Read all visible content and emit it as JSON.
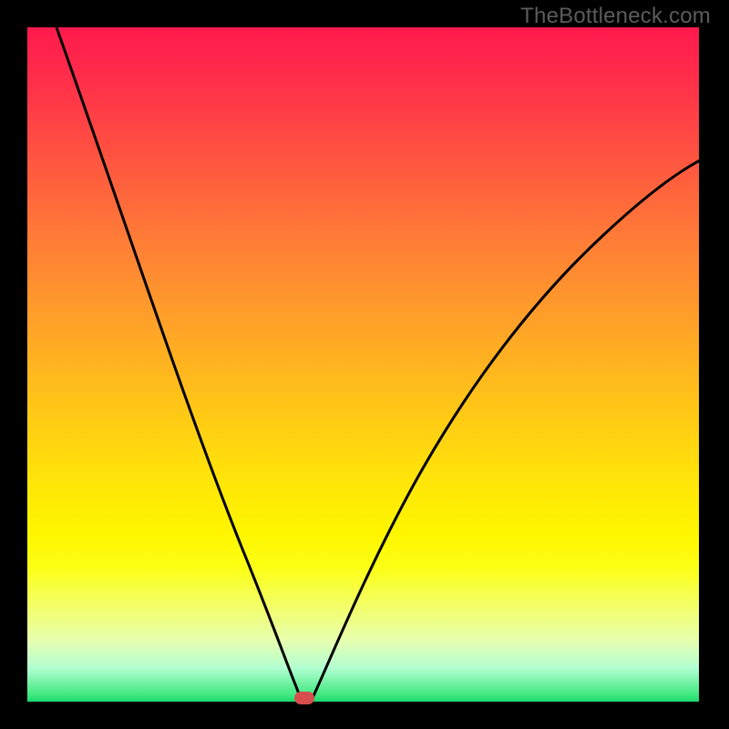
{
  "watermark": "TheBottleneck.com",
  "chart_data": {
    "type": "line",
    "title": "",
    "xlabel": "",
    "ylabel": "",
    "xlim": [
      0,
      100
    ],
    "ylim": [
      0,
      100
    ],
    "series": [
      {
        "name": "left-curve",
        "x": [
          4,
          10,
          16,
          22,
          28,
          32,
          35,
          37,
          38.5,
          40
        ],
        "y": [
          100,
          81,
          63,
          45,
          28,
          16,
          8,
          3,
          1,
          0
        ]
      },
      {
        "name": "right-curve",
        "x": [
          42,
          45,
          50,
          56,
          63,
          71,
          80,
          90,
          100
        ],
        "y": [
          0,
          5,
          15,
          28,
          41,
          53,
          63,
          71,
          77
        ]
      }
    ],
    "annotations": [
      {
        "name": "minimum-marker",
        "x": 40,
        "y": 0
      }
    ],
    "background_gradient": {
      "top": "#ff1a4d",
      "mid": "#ffe708",
      "bottom": "#1bd86e"
    }
  },
  "marker": {
    "color": "#d84e4e"
  }
}
